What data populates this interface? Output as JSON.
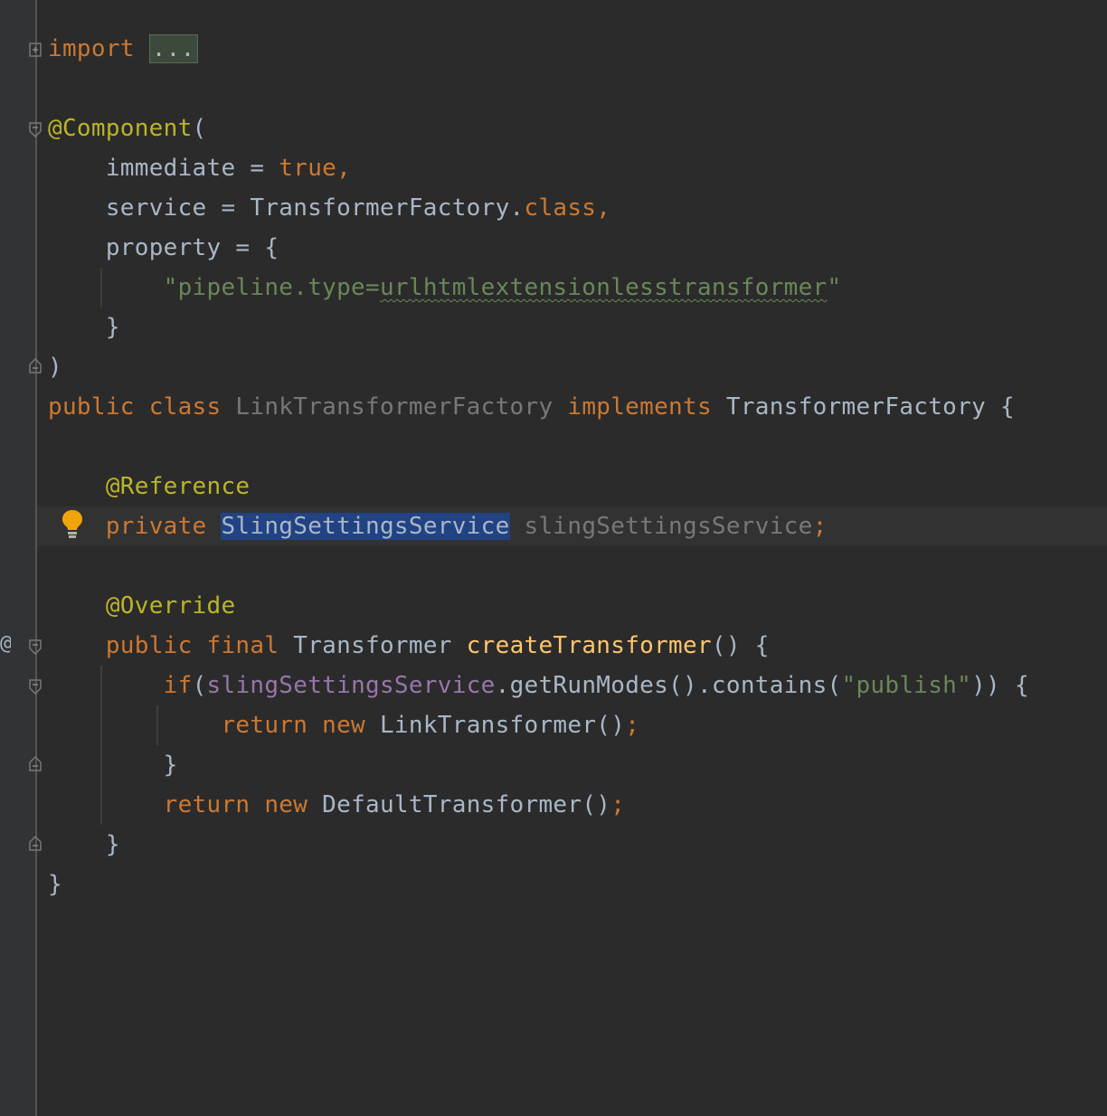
{
  "code": {
    "import_kw": "import",
    "import_fold": "...",
    "component_ann": "@Component",
    "paren_open": "(",
    "immediate_name": "immediate = ",
    "immediate_val": "true,",
    "service_name": "service = TransformerFactory.",
    "service_class": "class,",
    "property_name": "property = {",
    "property_str_a": "\"pipeline.type=",
    "property_str_b": "urlhtmlextensionlesstransformer",
    "property_str_c": "\"",
    "brace_close_1": "}",
    "paren_close": ")",
    "class_kw_public": "public ",
    "class_kw_class": "class ",
    "class_name": "LinkTransformerFactory",
    "class_implements": " implements ",
    "class_iface": "TransformerFactory {",
    "reference_ann": "@Reference",
    "field_private": "private ",
    "field_type": "SlingSettingsService",
    "field_name": " slingSettingsService",
    "field_semi": ";",
    "override_ann": "@Override",
    "method_public": "public ",
    "method_final": "final ",
    "method_type": "Transformer ",
    "method_name": "createTransformer",
    "method_rest": "() {",
    "if_kw": "if",
    "if_paren": "(",
    "if_field": "slingSettingsService",
    "if_call": ".getRunModes().contains(",
    "if_str": "\"publish\"",
    "if_end": ")) {",
    "ret1_kw": "return ",
    "ret1_new": "new ",
    "ret1_rest": "LinkTransformer()",
    "ret1_semi": ";",
    "brace_close_2": "}",
    "ret2_kw": "return ",
    "ret2_new": "new ",
    "ret2_rest": "DefaultTransformer()",
    "ret2_semi": ";",
    "brace_close_3": "}",
    "brace_close_4": "}"
  },
  "gutter": {
    "override_marker": "@",
    "bulb_icon": "lightbulb-icon"
  },
  "colors": {
    "background": "#2b2b2b",
    "keyword": "#cc7832",
    "annotation": "#bbb529",
    "string": "#6a8759",
    "function": "#ffc66d",
    "field": "#9876aa",
    "selection": "#214283"
  }
}
